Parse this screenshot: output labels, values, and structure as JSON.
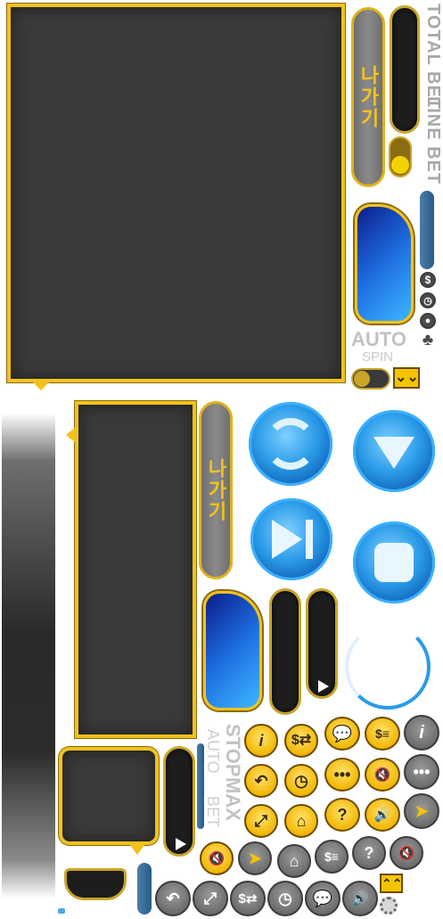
{
  "atlas": {
    "exit_label": "나가기",
    "total_bet_label": "TOTAL BET",
    "line_bet_label": "LINE BET",
    "auto_label": "AUTO",
    "spin_label": "SPIN",
    "stop_label": "STOP",
    "max_label": "MAX",
    "auto_label_small": "AUTO",
    "bet_label": "BET"
  },
  "colors": {
    "gold": "#f2c21b",
    "panel_dark": "#3a3a3a",
    "blue": "#2a9be8",
    "gray": "#7a7a7a"
  },
  "icons": {
    "side_icons": [
      "dollar-icon",
      "clock-icon",
      "user-icon",
      "club-icon"
    ],
    "gold_buttons": [
      "info-icon",
      "coin-swap-icon",
      "chat-icon",
      "paytable-icon",
      "back-icon",
      "history-icon",
      "more-icon",
      "mute-icon",
      "fullscreen-icon",
      "home-icon",
      "help-icon",
      "sound-icon"
    ],
    "gray_buttons": [
      "info-icon",
      "more-icon",
      "gold-arrow-icon",
      "mute-icon",
      "home-icon",
      "paytable-icon",
      "help-icon",
      "mute-icon",
      "back-icon",
      "fullscreen-icon",
      "coin-swap-icon",
      "history-icon",
      "chat-icon",
      "sound-icon"
    ]
  }
}
